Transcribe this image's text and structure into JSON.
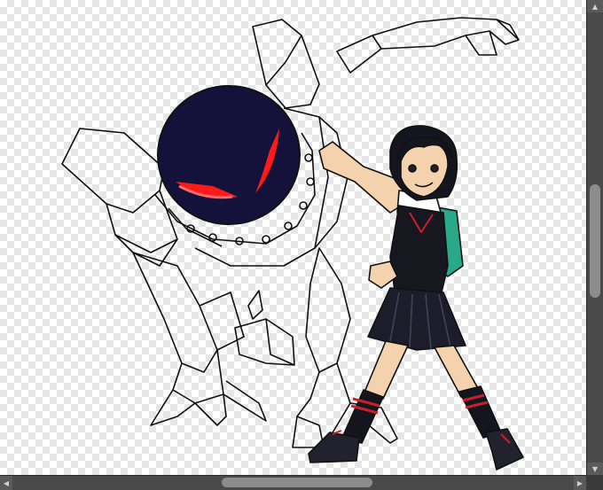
{
  "app": {
    "view": "image-canvas"
  },
  "scrollbars": {
    "vertical": {
      "up_glyph": "▲",
      "down_glyph": "▼",
      "position_fraction": 0.42
    },
    "horizontal": {
      "left_glyph": "◀",
      "right_glyph": "▶",
      "position_fraction": 0.5
    }
  },
  "artwork": {
    "subject": "girl-in-school-uniform-with-robot-sketch",
    "colors": {
      "robot_head": "#14123a",
      "robot_eyes": "#ff1a1a",
      "hair": "#15151f",
      "skin": "#f3d2ad",
      "vest": "#17171f",
      "skirt": "#1c1c2a",
      "backpack": "#2aa88a",
      "socks_stripe": "#c8202a",
      "outline": "#111111"
    }
  }
}
